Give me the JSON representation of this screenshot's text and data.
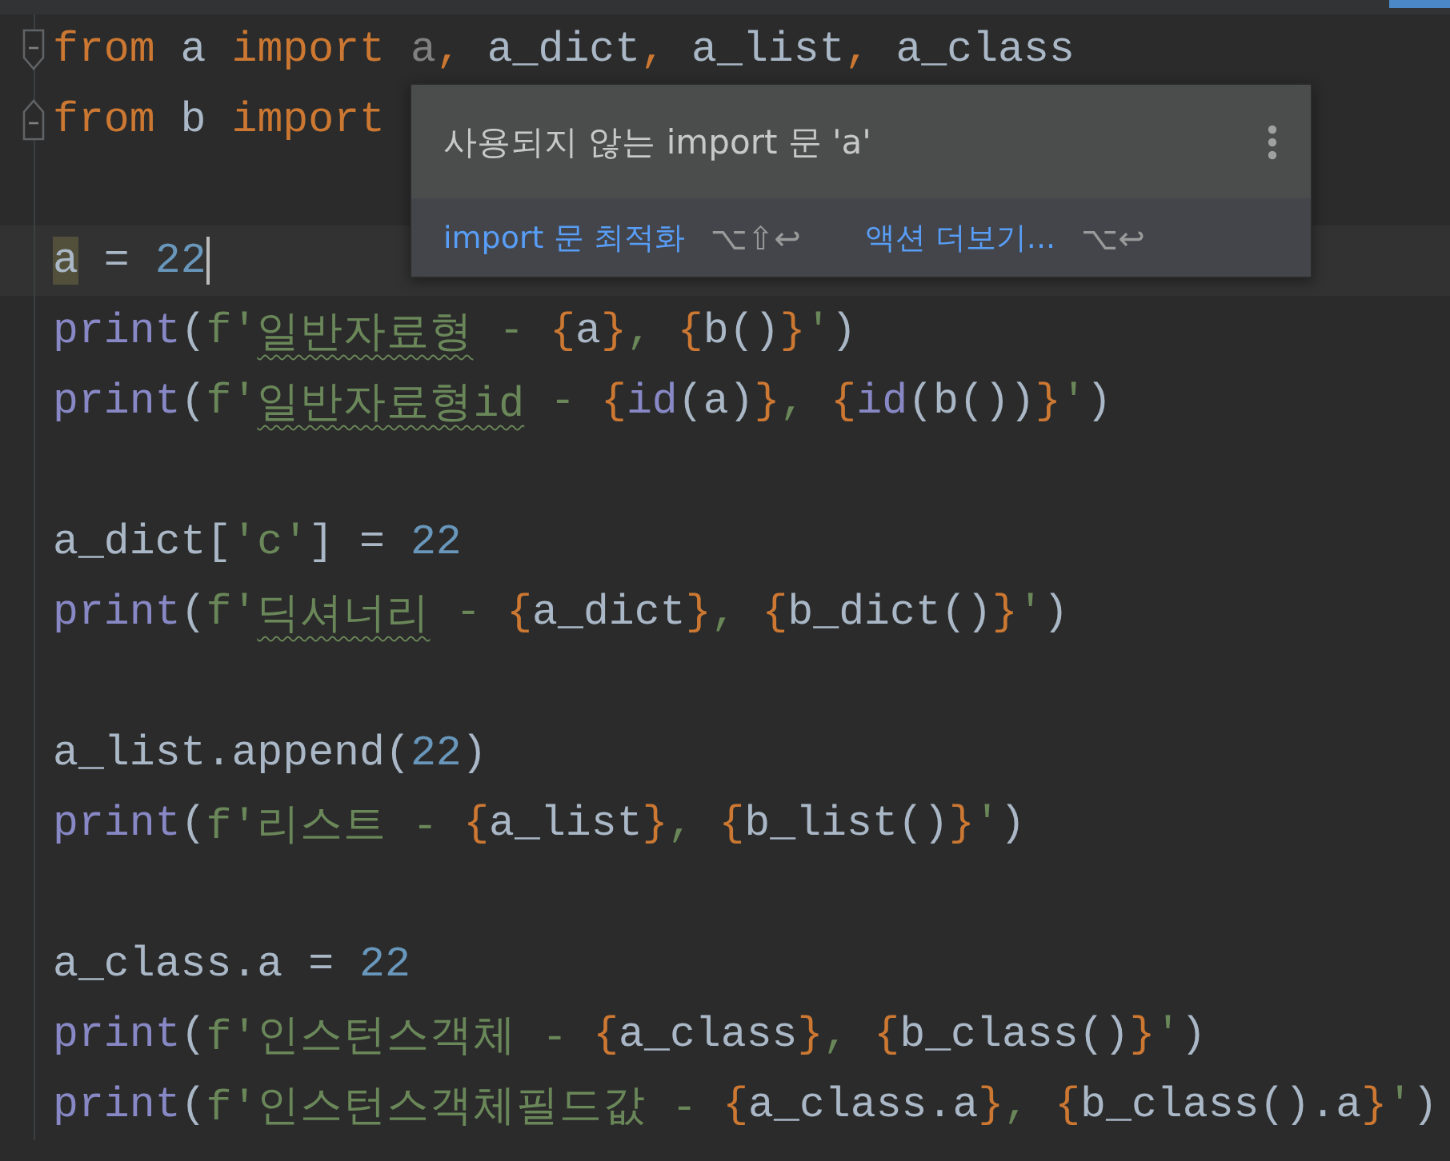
{
  "editor": {
    "lines": [
      {
        "fold": {
          "kind": "start"
        },
        "current": false,
        "tokens": [
          {
            "text": "from",
            "kind": "keyword"
          },
          {
            "text": " a ",
            "kind": "name"
          },
          {
            "text": "import",
            "kind": "keyword"
          },
          {
            "text": " a",
            "kind": "unused"
          },
          {
            "text": ",",
            "kind": "keyword"
          },
          {
            "text": " a_dict",
            "kind": "name"
          },
          {
            "text": ",",
            "kind": "keyword"
          },
          {
            "text": " a_list",
            "kind": "name"
          },
          {
            "text": ",",
            "kind": "keyword"
          },
          {
            "text": " a_class",
            "kind": "name"
          }
        ]
      },
      {
        "fold": {
          "kind": "end"
        },
        "current": false,
        "tokens": [
          {
            "text": "from",
            "kind": "keyword"
          },
          {
            "text": " b ",
            "kind": "name"
          },
          {
            "text": "import",
            "kind": "keyword"
          }
        ]
      },
      {
        "current": false
      },
      {
        "current": true,
        "tokens": [
          {
            "text": "a",
            "kind": "marked"
          },
          {
            "text": " = ",
            "kind": "name"
          },
          {
            "text": "22",
            "kind": "number"
          }
        ]
      },
      {
        "current": false,
        "tokens": [
          {
            "text": "print",
            "kind": "builtin"
          },
          {
            "text": "(",
            "kind": "name"
          },
          {
            "text": "f'",
            "kind": "string"
          },
          {
            "text": "일반자료형",
            "kind": "typo"
          },
          {
            "text": " - ",
            "kind": "string"
          },
          {
            "text": "{",
            "kind": "brace"
          },
          {
            "text": "a",
            "kind": "name"
          },
          {
            "text": "}",
            "kind": "brace"
          },
          {
            "text": ", ",
            "kind": "string"
          },
          {
            "text": "{",
            "kind": "brace"
          },
          {
            "text": "b()",
            "kind": "name"
          },
          {
            "text": "}",
            "kind": "brace"
          },
          {
            "text": "'",
            "kind": "string"
          },
          {
            "text": ")",
            "kind": "name"
          }
        ]
      },
      {
        "current": false,
        "tokens": [
          {
            "text": "print",
            "kind": "builtin"
          },
          {
            "text": "(",
            "kind": "name"
          },
          {
            "text": "f'",
            "kind": "string"
          },
          {
            "text": "일반자료형id",
            "kind": "typo"
          },
          {
            "text": " - ",
            "kind": "string"
          },
          {
            "text": "{",
            "kind": "brace"
          },
          {
            "text": "id",
            "kind": "builtin"
          },
          {
            "text": "(a)",
            "kind": "name"
          },
          {
            "text": "}",
            "kind": "brace"
          },
          {
            "text": ", ",
            "kind": "string"
          },
          {
            "text": "{",
            "kind": "brace"
          },
          {
            "text": "id",
            "kind": "builtin"
          },
          {
            "text": "(b())",
            "kind": "name"
          },
          {
            "text": "}",
            "kind": "brace"
          },
          {
            "text": "'",
            "kind": "string"
          },
          {
            "text": ")",
            "kind": "name"
          }
        ]
      },
      {
        "current": false
      },
      {
        "current": false,
        "tokens": [
          {
            "text": "a_dict[",
            "kind": "name"
          },
          {
            "text": "'c'",
            "kind": "string"
          },
          {
            "text": "] = ",
            "kind": "name"
          },
          {
            "text": "22",
            "kind": "number"
          }
        ]
      },
      {
        "current": false,
        "tokens": [
          {
            "text": "print",
            "kind": "builtin"
          },
          {
            "text": "(",
            "kind": "name"
          },
          {
            "text": "f'",
            "kind": "string"
          },
          {
            "text": "딕셔너리",
            "kind": "typo"
          },
          {
            "text": " - ",
            "kind": "string"
          },
          {
            "text": "{",
            "kind": "brace"
          },
          {
            "text": "a_dict",
            "kind": "name"
          },
          {
            "text": "}",
            "kind": "brace"
          },
          {
            "text": ", ",
            "kind": "string"
          },
          {
            "text": "{",
            "kind": "brace"
          },
          {
            "text": "b_dict()",
            "kind": "name"
          },
          {
            "text": "}",
            "kind": "brace"
          },
          {
            "text": "'",
            "kind": "string"
          },
          {
            "text": ")",
            "kind": "name"
          }
        ]
      },
      {
        "current": false
      },
      {
        "current": false,
        "tokens": [
          {
            "text": "a_list.append(",
            "kind": "name"
          },
          {
            "text": "22",
            "kind": "number"
          },
          {
            "text": ")",
            "kind": "name"
          }
        ]
      },
      {
        "current": false,
        "tokens": [
          {
            "text": "print",
            "kind": "builtin"
          },
          {
            "text": "(",
            "kind": "name"
          },
          {
            "text": "f'리스트 - ",
            "kind": "string"
          },
          {
            "text": "{",
            "kind": "brace"
          },
          {
            "text": "a_list",
            "kind": "name"
          },
          {
            "text": "}",
            "kind": "brace"
          },
          {
            "text": ", ",
            "kind": "string"
          },
          {
            "text": "{",
            "kind": "brace"
          },
          {
            "text": "b_list()",
            "kind": "name"
          },
          {
            "text": "}",
            "kind": "brace"
          },
          {
            "text": "'",
            "kind": "string"
          },
          {
            "text": ")",
            "kind": "name"
          }
        ]
      },
      {
        "current": false
      },
      {
        "current": false,
        "tokens": [
          {
            "text": "a_class.a = ",
            "kind": "name"
          },
          {
            "text": "22",
            "kind": "number"
          }
        ]
      },
      {
        "current": false,
        "tokens": [
          {
            "text": "print",
            "kind": "builtin"
          },
          {
            "text": "(",
            "kind": "name"
          },
          {
            "text": "f'인스턴스객체 - ",
            "kind": "string"
          },
          {
            "text": "{",
            "kind": "brace"
          },
          {
            "text": "a_class",
            "kind": "name"
          },
          {
            "text": "}",
            "kind": "brace"
          },
          {
            "text": ", ",
            "kind": "string"
          },
          {
            "text": "{",
            "kind": "brace"
          },
          {
            "text": "b_class()",
            "kind": "name"
          },
          {
            "text": "}",
            "kind": "brace"
          },
          {
            "text": "'",
            "kind": "string"
          },
          {
            "text": ")",
            "kind": "name"
          }
        ]
      },
      {
        "current": false,
        "tokens": [
          {
            "text": "print",
            "kind": "builtin"
          },
          {
            "text": "(",
            "kind": "name"
          },
          {
            "text": "f'인스턴스객체필드값 - ",
            "kind": "string"
          },
          {
            "text": "{",
            "kind": "brace"
          },
          {
            "text": "a_class.a",
            "kind": "name"
          },
          {
            "text": "}",
            "kind": "brace"
          },
          {
            "text": ", ",
            "kind": "string"
          },
          {
            "text": "{",
            "kind": "brace"
          },
          {
            "text": "b_class().a",
            "kind": "name"
          },
          {
            "text": "}",
            "kind": "brace"
          },
          {
            "text": "'",
            "kind": "string"
          },
          {
            "text": ")",
            "kind": "name"
          }
        ]
      }
    ]
  },
  "popup": {
    "message": "사용되지 않는 import 문 'a'",
    "actions": [
      {
        "label": "import 문 최적화",
        "shortcut": "⌥⇧↩"
      },
      {
        "label": "액션 더보기...",
        "shortcut": "⌥↩"
      }
    ]
  }
}
